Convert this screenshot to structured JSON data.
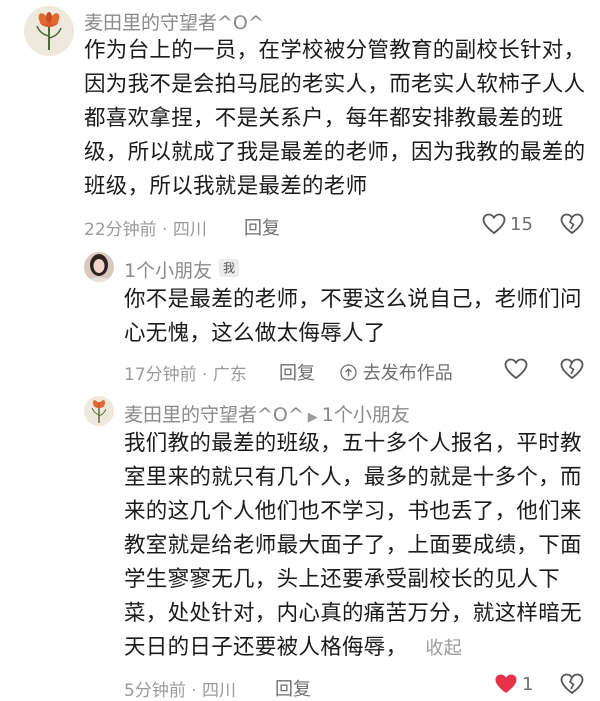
{
  "comment1": {
    "username": "麦田里的守望者^O^",
    "lines": [
      "作为台上的一员，在学校被分管教育的副校长针对，",
      "因为我不是会拍马屁的老实人，而老实人软柿子人人",
      "都喜欢拿捏，不是关系户，每年都安排教最差的班",
      "级，所以就成了我是最差的老师，因为我教的最差的",
      "班级，所以我就是最差的老师"
    ],
    "meta": "22分钟前 · 四川",
    "reply_label": "回复",
    "like_count": "15"
  },
  "reply1": {
    "username": "1个小朋友",
    "badge": "我",
    "lines": [
      "你不是最差的老师，不要这么说自己，老师们问",
      "心无愧，这么做太侮辱人了"
    ],
    "meta": "17分钟前 · 广东",
    "reply_label": "回复",
    "publish_label": "去发布作品"
  },
  "reply2": {
    "username": "麦田里的守望者^O^",
    "reply_to": "1个小朋友",
    "lines": [
      "我们教的最差的班级，五十多个人报名，平时教",
      "室里来的就只有几个人，最多的就是十多个，而",
      "来的这几个人他们也不学习，书也丢了，他们来",
      "教室就是给老师最大面子了，上面要成绩，下面",
      "学生寥寥无几，头上还要承受副校长的见人下",
      "菜，处处针对，内心真的痛苦万分，就这样暗无",
      "天日的日子还要被人格侮辱，"
    ],
    "collapse_label": "收起",
    "meta": "5分钟前 · 四川",
    "reply_label": "回复",
    "like_count": "1"
  },
  "colors": {
    "text": "#1b1b1b",
    "meta": "#9b9b9b",
    "like_active": "#e8324a"
  }
}
